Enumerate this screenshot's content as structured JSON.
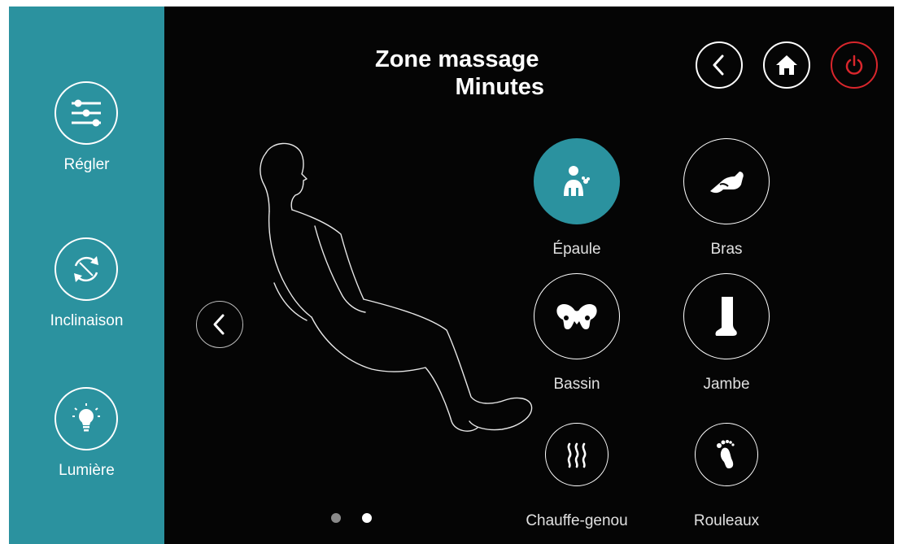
{
  "header": {
    "title_line1": "Zone massage",
    "title_line2": "Minutes"
  },
  "sidebar": {
    "items": [
      {
        "label": "Régler",
        "icon": "sliders-icon"
      },
      {
        "label": "Inclinaison",
        "icon": "recline-cycle-icon"
      },
      {
        "label": "Lumière",
        "icon": "lightbulb-icon"
      }
    ]
  },
  "top_buttons": [
    {
      "icon": "back-chevron-icon"
    },
    {
      "icon": "home-icon"
    },
    {
      "icon": "power-icon",
      "color": "#d9262c"
    }
  ],
  "zones": [
    {
      "label": "Épaule",
      "icon": "shoulder-icon",
      "active": true
    },
    {
      "label": "Bras",
      "icon": "arm-icon",
      "active": false
    },
    {
      "label": "Bassin",
      "icon": "pelvis-icon",
      "active": false
    },
    {
      "label": "Jambe",
      "icon": "leg-icon",
      "active": false
    },
    {
      "label": "Chauffe-genou",
      "icon": "heat-icon",
      "active": false
    },
    {
      "label": "Rouleaux",
      "icon": "foot-icon",
      "active": false
    }
  ],
  "pagination": {
    "total": 2,
    "current": 2
  },
  "colors": {
    "accent": "#2b929f",
    "background": "#050505",
    "power": "#d9262c",
    "dot_inactive": "#8a8a8a",
    "dot_active": "#ffffff"
  }
}
